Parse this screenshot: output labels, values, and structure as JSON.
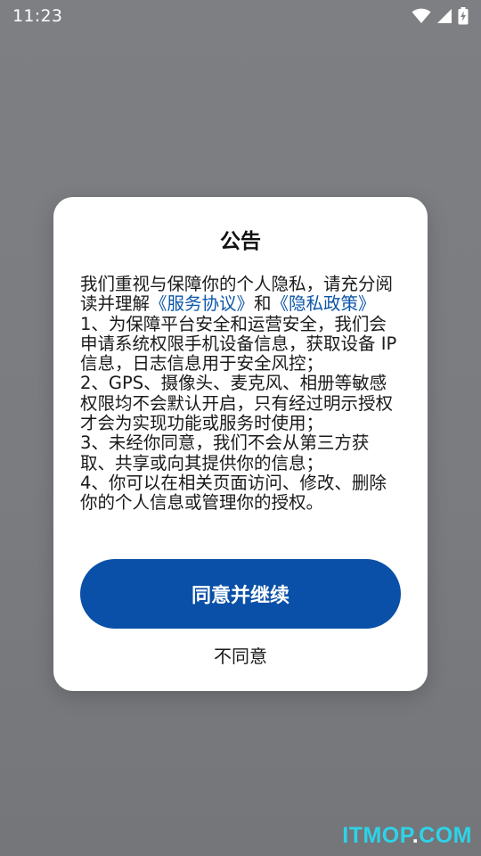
{
  "status_bar": {
    "time": "11:23",
    "icons": [
      "wifi-icon",
      "cellular-signal-icon",
      "battery-charging-icon"
    ]
  },
  "dialog": {
    "title": "公告",
    "intro_text": "我们重视与保障你的个人隐私，请充分阅读并理解",
    "service_link": "《服务协议》",
    "and_text": "和",
    "privacy_link": "《隐私政策》",
    "items": [
      "1、为保障平台安全和运营安全，我们会申请系统权限手机设备信息，获取设备 IP 信息，日志信息用于安全风控；",
      "2、GPS、摄像头、麦克风、相册等敏感权限均不会默认开启，只有经过明示授权才会为实现功能或服务时使用；",
      "3、未经你同意，我们不会从第三方获取、共享或向其提供你的信息；",
      "4、你可以在相关页面访问、修改、删除你的个人信息或管理你的授权。"
    ],
    "agree_label": "同意并继续",
    "disagree_label": "不同意"
  },
  "watermark": {
    "main": "ITMOP",
    "dot": ".",
    "tld": "COM"
  },
  "colors": {
    "accent": "#0a50a8",
    "link": "#0b56a8",
    "overlay": "#7d7f83",
    "watermark": "#2dd3e8"
  }
}
